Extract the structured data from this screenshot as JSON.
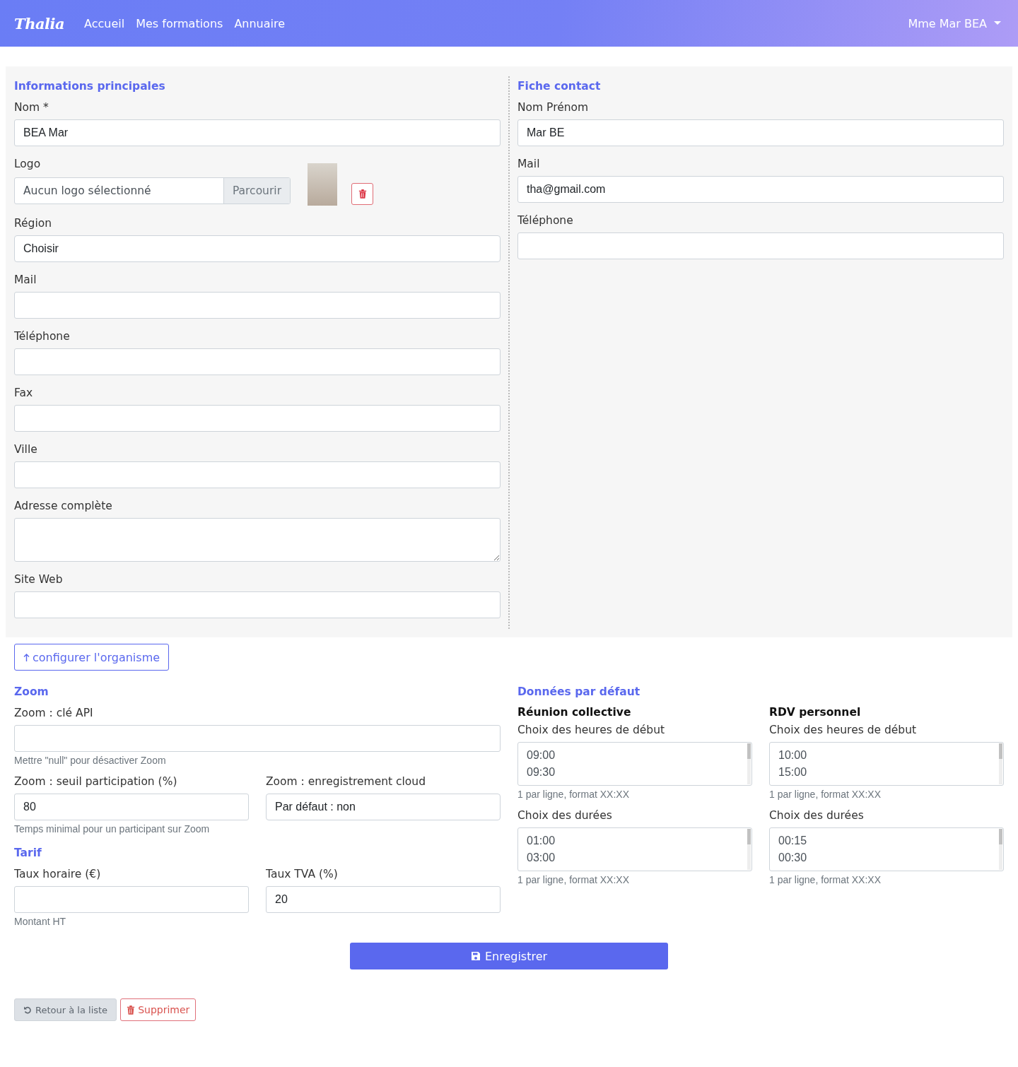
{
  "navbar": {
    "brand": "Thalia",
    "links": [
      {
        "label": "Accueil"
      },
      {
        "label": "Mes formations"
      },
      {
        "label": "Annuaire"
      }
    ],
    "user": "Mme Mar BEA"
  },
  "main_info": {
    "title": "Informations principales",
    "fields": [
      {
        "kind": "text",
        "label": "Nom *",
        "value": "BEA Mar"
      },
      {
        "kind": "file",
        "label": "Logo",
        "placeholder": "Aucun logo sélectionné",
        "button": "Parcourir"
      },
      {
        "kind": "select",
        "label": "Région",
        "value": "Choisir"
      },
      {
        "kind": "text",
        "label": "Mail"
      },
      {
        "kind": "text",
        "label": "Téléphone"
      },
      {
        "kind": "text",
        "label": "Fax"
      },
      {
        "kind": "text",
        "label": "Ville"
      },
      {
        "kind": "textarea",
        "label": "Adresse complète"
      },
      {
        "kind": "text",
        "label": "Site Web"
      }
    ]
  },
  "contact": {
    "title": "Fiche contact",
    "fields": [
      {
        "kind": "text",
        "label": "Nom Prénom",
        "value": "Mar BE"
      },
      {
        "kind": "text",
        "label": "Mail",
        "value": "tha@gmail.com"
      },
      {
        "kind": "text",
        "label": "Téléphone"
      }
    ]
  },
  "configure_button": "configurer l'organisme",
  "zoom": {
    "title": "Zoom",
    "rows": [
      [
        {
          "kind": "text",
          "label": "Zoom : clé API",
          "help": "Mettre \"null\" pour désactiver Zoom"
        }
      ],
      [
        {
          "kind": "text",
          "label": "Zoom : seuil participation (%)",
          "value": "80",
          "help": "Temps minimal pour un participant sur Zoom"
        },
        {
          "kind": "select",
          "label": "Zoom : enregistrement cloud",
          "value": "Par défaut : non"
        }
      ]
    ]
  },
  "tarif": {
    "title": "Tarif",
    "rows": [
      [
        {
          "kind": "text",
          "label": "Taux horaire (€)",
          "help": "Montant HT"
        },
        {
          "kind": "text",
          "label": "Taux TVA (%)",
          "value": "20"
        }
      ]
    ]
  },
  "defaults": {
    "title": "Données par défaut",
    "groups": [
      {
        "title": "Réunion collective",
        "fields": [
          {
            "kind": "list",
            "label": "Choix des heures de début",
            "lines": [
              "09:00",
              "09:30"
            ],
            "help": "1 par ligne, format XX:XX"
          },
          {
            "kind": "list",
            "label": "Choix des durées",
            "lines": [
              "01:00",
              "03:00"
            ],
            "help": "1 par ligne, format XX:XX"
          }
        ]
      },
      {
        "title": "RDV personnel",
        "fields": [
          {
            "kind": "list",
            "label": "Choix des heures de début",
            "lines": [
              "10:00",
              "15:00"
            ],
            "help": "1 par ligne, format XX:XX"
          },
          {
            "kind": "list",
            "label": "Choix des durées",
            "lines": [
              "00:15",
              "00:30"
            ],
            "help": "1 par ligne, format XX:XX"
          }
        ]
      }
    ]
  },
  "save_button": "Enregistrer",
  "back_button": "Retour à la liste",
  "delete_button": "Supprimer"
}
